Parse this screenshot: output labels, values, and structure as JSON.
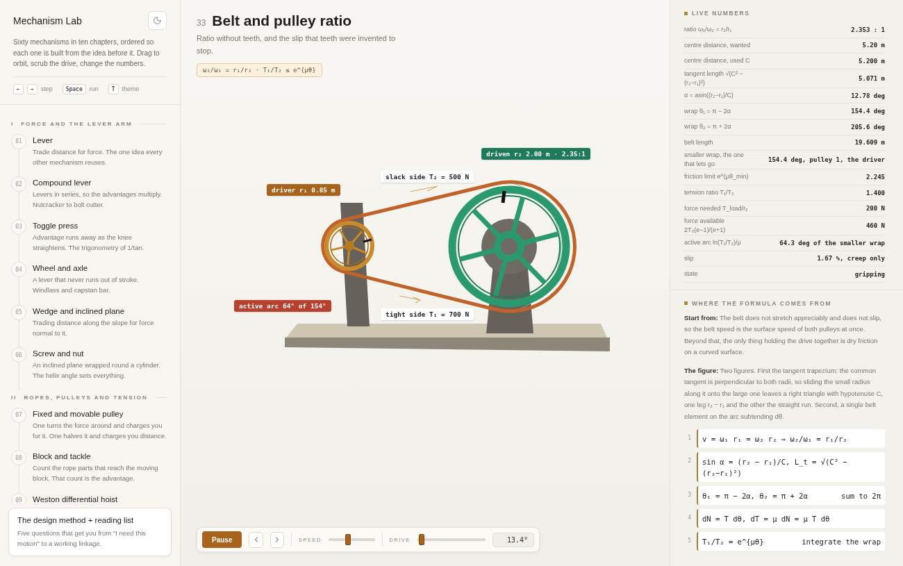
{
  "sidebar": {
    "title": "Mechanism Lab",
    "intro": "Sixty mechanisms in ten chapters, ordered so each one is built from the idea before it. Drag to orbit, scrub the drive, change the numbers.",
    "hints": [
      {
        "keys": [
          "←",
          "→"
        ],
        "label": "step"
      },
      {
        "keys": [
          "Space"
        ],
        "label": "run"
      },
      {
        "keys": [
          "T"
        ],
        "label": "theme"
      }
    ],
    "chapters": [
      {
        "numeral": "I",
        "title": "FORCE AND THE LEVER ARM",
        "items": [
          {
            "number": "01",
            "title": "Lever",
            "description": "Trade distance for force. The one idea every other mechanism reuses."
          },
          {
            "number": "02",
            "title": "Compound lever",
            "description": "Levers in series, so the advantages multiply. Nutcracker to bolt cutter."
          },
          {
            "number": "03",
            "title": "Toggle press",
            "description": "Advantage runs away as the knee straightens. The trigonometry of 1/tan."
          },
          {
            "number": "04",
            "title": "Wheel and axle",
            "description": "A lever that never runs out of stroke. Windlass and capstan bar."
          },
          {
            "number": "05",
            "title": "Wedge and inclined plane",
            "description": "Trading distance along the slope for force normal to it."
          },
          {
            "number": "06",
            "title": "Screw and nut",
            "description": "An inclined plane wrapped round a cylinder. The helix angle sets everything."
          }
        ]
      },
      {
        "numeral": "II",
        "title": "ROPES, PULLEYS AND TENSION",
        "items": [
          {
            "number": "07",
            "title": "Fixed and movable pulley",
            "description": "One turns the force around and charges you for it. One halves it and charges you distance."
          },
          {
            "number": "08",
            "title": "Block and tackle",
            "description": "Count the rope parts that reach the moving block. That count is the advantage."
          },
          {
            "number": "09",
            "title": "Weston differential hoist"
          }
        ]
      }
    ],
    "footer_card": {
      "title": "The design method + reading list",
      "description": "Five questions that get you from \"I need this motion\" to a working linkage."
    }
  },
  "lesson": {
    "number": "33",
    "title": "Belt and pulley ratio",
    "subtitle": "Ratio without teeth, and the slip that teeth were invented to stop.",
    "formula": "ω₂/ω₁ = r₁/r₂ · T₁/T₂ ≤ e^{μθ}"
  },
  "scene_labels": [
    {
      "text": "driven r₂ 2.00 m · 2.35:1",
      "color": "#1e7a5a"
    },
    {
      "text": "slack side T₂ = 500 N",
      "color": "#ffffff"
    },
    {
      "text": "driver r₁ 0.85 m",
      "color": "#a8641c"
    },
    {
      "text": "active arc 64° of 154°",
      "color": "#b8402f"
    },
    {
      "text": "tight side T₁ = 700 N",
      "color": "#ffffff"
    }
  ],
  "controls": {
    "play_button": "Pause",
    "sliders": [
      {
        "label": "SPEED",
        "level": 0.42
      },
      {
        "label": "DRIVE",
        "level": 0.06
      }
    ],
    "readout": "13.4°"
  },
  "live_numbers": {
    "title": "LIVE NUMBERS",
    "rows": [
      {
        "label": "ratio ω₁/ω₂ = r₂/r₁",
        "value": "2.353 : 1"
      },
      {
        "label": "centre distance, wanted",
        "value": "5.20 m"
      },
      {
        "label": "centre distance, used C",
        "value": "5.200 m"
      },
      {
        "label": "tangent length √(C² − (r₂−r₁)²)",
        "value": "5.071 m"
      },
      {
        "label": "α = asin((r₂−r₁)/C)",
        "value": "12.78 deg"
      },
      {
        "label": "wrap θ₁ = π − 2α",
        "value": "154.4 deg"
      },
      {
        "label": "wrap θ₂ = π + 2α",
        "value": "205.6 deg"
      },
      {
        "label": "belt length",
        "value": "19.609 m"
      },
      {
        "label": "smaller wrap, the one that lets go",
        "value": "154.4 deg, pulley 1, the driver"
      },
      {
        "label": "friction limit e^(μθ_min)",
        "value": "2.245"
      },
      {
        "label": "tension ratio T₁/T₂",
        "value": "1.400"
      },
      {
        "label": "force needed T_load/r₂",
        "value": "200 N"
      },
      {
        "label": "force available 2T₀(e−1)/(e+1)",
        "value": "460 N"
      },
      {
        "label": "active arc ln(T₁/T₂)/μ",
        "value": "64.3 deg of the smaller wrap"
      },
      {
        "label": "slip",
        "value": "1.67 %, creep only"
      },
      {
        "label": "state",
        "value": "gripping"
      }
    ]
  },
  "derivation": {
    "title": "WHERE THE FORMULA COMES FROM",
    "paragraphs": [
      "**Start from:** The belt does not stretch appreciably and does not slip, so the belt speed is the surface speed of both pulleys at once. Beyond that, the only thing holding the drive together is dry friction on a curved surface.",
      "**The figure:** Two figures. First the tangent trapezium: the common tangent is perpendicular to both radii, so sliding the small radius along it onto the large one leaves a right triangle with hypotenuse C, one leg r₂ − r₁ and the other the straight run. Second, a single belt element on the arc subtending dθ."
    ],
    "steps": [
      {
        "number": "1",
        "formula": "v = ω₁ r₁ = ω₂ r₂  ⇒  ω₂/ω₁ = r₁/r₂"
      },
      {
        "number": "2",
        "formula": "sin α = (r₂ − r₁)/C,  L_t = √(C² − (r₂−r₁)²)"
      },
      {
        "number": "3",
        "formula": "θ₁ = π − 2α,  θ₂ = π + 2α",
        "note": "sum to 2π"
      },
      {
        "number": "4",
        "formula": "dN = T dθ,   dT = μ dN = μ T dθ"
      },
      {
        "number": "5",
        "formula": "T₁/T₂ = e^{μθ}",
        "note": "integrate the wrap"
      }
    ]
  }
}
